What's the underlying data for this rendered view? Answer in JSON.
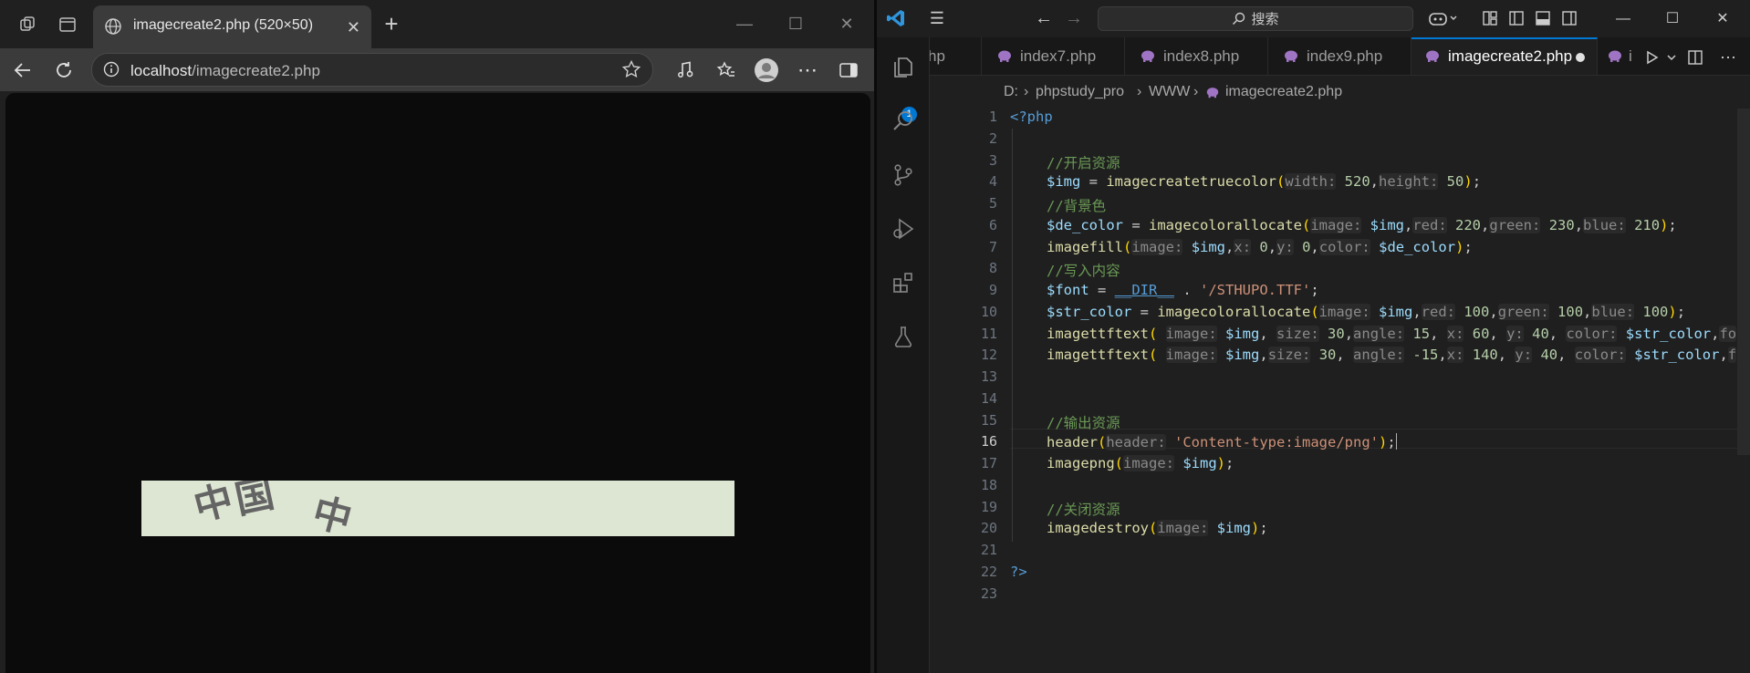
{
  "browser": {
    "tab_title": "imagecreate2.php (520×50)",
    "url_host": "localhost",
    "url_path": "/imagecreate2.php",
    "rendered_image": {
      "glyph_1": "中",
      "glyph_2": "国",
      "glyph_3": "中",
      "background": "#dce6d2",
      "text_color": "#646464"
    }
  },
  "vscode": {
    "search_label": "搜索",
    "badge_count": "1",
    "tabs": [
      {
        "label": "hp"
      },
      {
        "label": "index7.php"
      },
      {
        "label": "index8.php"
      },
      {
        "label": "index9.php"
      },
      {
        "label": "imagecreate2.php"
      },
      {
        "label": "i"
      }
    ],
    "breadcrumb": [
      "D:",
      "phpstudy_pro",
      "WWW",
      "imagecreate2.php"
    ],
    "line_numbers": [
      "1",
      "2",
      "3",
      "4",
      "5",
      "6",
      "7",
      "8",
      "9",
      "10",
      "11",
      "12",
      "13",
      "14",
      "15",
      "16",
      "17",
      "18",
      "19",
      "20",
      "21",
      "22",
      "23"
    ],
    "code": {
      "l1": "<?php",
      "l3": "//开启资源",
      "l4_var": "$img",
      "l4_fn": "imagecreatetruecolor",
      "l4_h1": "width:",
      "l4_v1": "520",
      "l4_h2": "height:",
      "l4_v2": "50",
      "l5": "//背景色",
      "l6_var": "$de_color",
      "l6_fn": "imagecolorallocate",
      "l6_h1": "image:",
      "l6_a1": "$img",
      "l6_h2": "red:",
      "l6_v2": "220",
      "l6_h3": "green:",
      "l6_v3": "230",
      "l6_h4": "blue:",
      "l6_v4": "210",
      "l7_fn": "imagefill",
      "l7_h1": "image:",
      "l7_a1": "$img",
      "l7_h2": "x:",
      "l7_v2": "0",
      "l7_h3": "y:",
      "l7_v3": "0",
      "l7_h4": "color:",
      "l7_a4": "$de_color",
      "l8": "//写入内容",
      "l9_var": "$font",
      "l9_const": "__DIR__",
      "l9_str": "'/STHUPO.TTF'",
      "l10_var": "$str_color",
      "l10_fn": "imagecolorallocate",
      "l10_h1": "image:",
      "l10_a1": "$img",
      "l10_h2": "red:",
      "l10_v2": "100",
      "l10_h3": "green:",
      "l10_v3": "100",
      "l10_h4": "blue:",
      "l10_v4": "100",
      "l11_fn": "imagettftext",
      "l11_h1": "image:",
      "l11_a1": "$img",
      "l11_h2": "size:",
      "l11_v2": "30",
      "l11_h3": "angle:",
      "l11_v3": "15",
      "l11_h4": "x:",
      "l11_v4": "60",
      "l11_h5": "y:",
      "l11_v5": "40",
      "l11_h6": "color:",
      "l11_a6": "$str_color",
      "l11_tail": "fo",
      "l12_fn": "imagettftext",
      "l12_h1": "image:",
      "l12_a1": "$img",
      "l12_h2": "size:",
      "l12_v2": "30",
      "l12_h3": "angle:",
      "l12_v3": "-15",
      "l12_h4": "x:",
      "l12_v4": "140",
      "l12_h5": "y:",
      "l12_v5": "40",
      "l12_h6": "color:",
      "l12_a6": "$str_color",
      "l12_tail": "f",
      "l15": "//输出资源",
      "l16_fn": "header",
      "l16_h1": "header:",
      "l16_str": "'Content-type:image/png'",
      "l17_fn": "imagepng",
      "l17_h1": "image:",
      "l17_a1": "$img",
      "l19": "//关闭资源",
      "l20_fn": "imagedestroy",
      "l20_h1": "image:",
      "l20_a1": "$img",
      "l22": "?>"
    }
  },
  "colors": {
    "accent": "#0078d4",
    "editor_bg": "#1f1f1f",
    "browser_bg": "#202020"
  }
}
